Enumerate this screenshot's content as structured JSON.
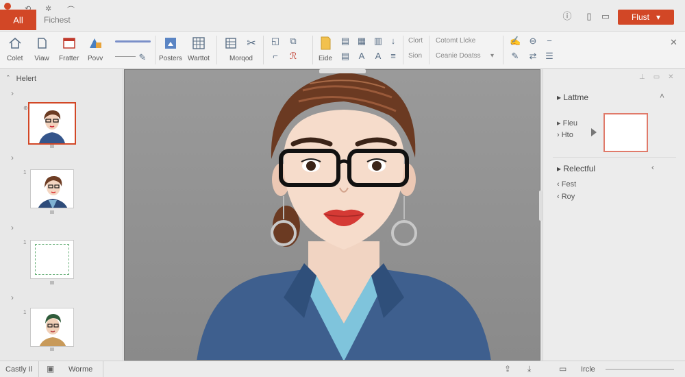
{
  "titlebar": {
    "active_tab": "All",
    "second_tab": "Fichest",
    "primary_button": "Flust",
    "colors": {
      "accent": "#d24726"
    },
    "right_icons": [
      "info-icon",
      "phone-icon",
      "minimize-icon",
      "restore-icon",
      "close-icon"
    ]
  },
  "ribbon": {
    "buttons": [
      {
        "label": "Colet",
        "icon": "home-icon"
      },
      {
        "label": "Viaw",
        "icon": "view-icon"
      },
      {
        "label": "Fratter",
        "icon": "slide-icon"
      },
      {
        "label": "Povv",
        "icon": "paint-icon"
      },
      {
        "label": "Posters",
        "icon": "poster-icon"
      },
      {
        "label": "Warttot",
        "icon": "grid-icon"
      },
      {
        "label": "Morqod",
        "icon": "table-icon"
      },
      {
        "label": "Eide",
        "icon": "note-icon"
      }
    ],
    "text_col1": [
      "Clort",
      "Sion"
    ],
    "text_col2": [
      "Cotomt Llcke",
      "Ceanie Doatss"
    ]
  },
  "left_panel": {
    "header": "Helert"
  },
  "right_panel": {
    "section1_title": "Lattme",
    "section1_items": [
      "Fleu",
      "Hto"
    ],
    "section2_title": "Relectful",
    "section2_items": [
      "Fest",
      "Roy"
    ]
  },
  "status": {
    "slide_label": "Castly Il",
    "view_label": "Worme",
    "zoom_label": "Ircle"
  }
}
